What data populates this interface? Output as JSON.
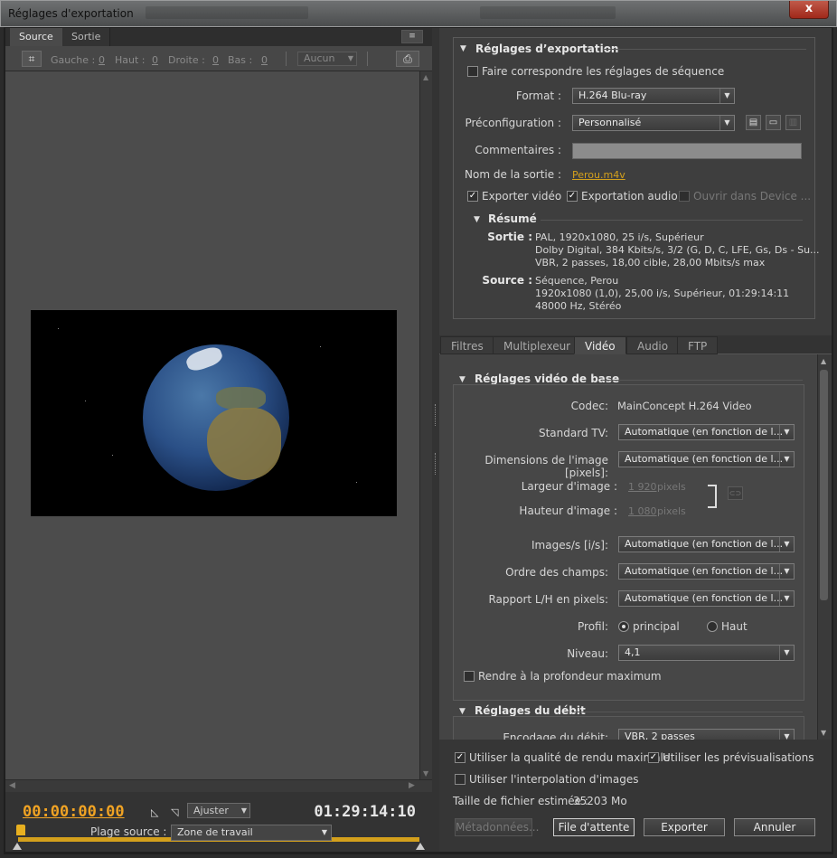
{
  "window": {
    "title": "Réglages d'exportation",
    "close_label": "x"
  },
  "left": {
    "tabs": [
      "Source",
      "Sortie"
    ],
    "panel_menu_label": "≡",
    "crop": {
      "left_label": "Gauche :",
      "left_value": "0",
      "top_label": "Haut :",
      "top_value": "0",
      "right_label": "Droite :",
      "right_value": "0",
      "bottom_label": "Bas :",
      "bottom_value": "0",
      "ratio_value": "Aucun"
    },
    "transport": {
      "timecode_start": "00:00:00:00",
      "timecode_end": "01:29:14:10",
      "zoom_value": "Ajuster"
    },
    "source_range": {
      "label": "Plage source :",
      "value": "Zone de travail"
    }
  },
  "export": {
    "title": "Réglages d’exportation",
    "match_sequence_label": "Faire correspondre les réglages de séquence",
    "format_label": "Format :",
    "format_value": "H.264 Blu-ray",
    "preset_label": "Préconfiguration :",
    "preset_value": "Personnalisé",
    "comments_label": "Commentaires :",
    "output_name_label": "Nom de la sortie :",
    "output_name_value": "Perou.m4v",
    "export_video_label": "Exporter vidéo",
    "export_audio_label": "Exportation audio",
    "open_device_label": "Ouvrir dans Device ...",
    "summary_title": "Résumé",
    "summary_output_label": "Sortie :",
    "summary_output_lines": [
      "PAL, 1920x1080, 25 i/s, Supérieur",
      "Dolby Digital, 384 Kbits/s, 3/2 (G, D, C, LFE, Gs, Ds - Su...",
      "VBR, 2 passes, 18,00 cible, 28,00 Mbits/s max"
    ],
    "summary_source_label": "Source :",
    "summary_source_lines": [
      "Séquence, Perou",
      "1920x1080 (1,0), 25,00 i/s, Supérieur, 01:29:14:11",
      "48000 Hz, Stéréo"
    ]
  },
  "tabs": [
    "Filtres",
    "Multiplexeur",
    "Vidéo",
    "Audio",
    "FTP"
  ],
  "video": {
    "basic_title": "Réglages vidéo de base",
    "codec_label": "Codec:",
    "codec_value": "MainConcept H.264 Video",
    "tv_standard_label": "Standard TV:",
    "tv_standard_value": "Automatique (en fonction de l...",
    "frame_size_label": "Dimensions de l'image [pixels]:",
    "frame_size_value": "Automatique (en fonction de l...",
    "width_label": "Largeur d'image :",
    "width_value": "1 920",
    "height_label": "Hauteur d'image :",
    "height_value": "1 080",
    "unit_pixels": "pixels",
    "fps_label": "Images/s [i/s]:",
    "fps_value": "Automatique (en fonction de l...",
    "field_order_label": "Ordre des champs:",
    "field_order_value": "Automatique (en fonction de l...",
    "aspect_label": "Rapport L/H en pixels:",
    "aspect_value": "Automatique (en fonction de l...",
    "profile_label": "Profil:",
    "profile_main": "principal",
    "profile_high": "Haut",
    "level_label": "Niveau:",
    "level_value": "4,1",
    "max_depth_label": "Rendre à la profondeur maximum",
    "bitrate_title": "Réglages du débit",
    "bitrate_encoding_label": "Encodage du débit:",
    "bitrate_encoding_value": "VBR, 2 passes"
  },
  "bottom": {
    "max_render_label": "Utiliser la qualité de rendu maximale",
    "use_previews_label": "Utiliser les prévisualisations",
    "frame_blending_label": "Utiliser l'interpolation d'images",
    "file_size_label": "Taille de fichier estimée :",
    "file_size_value": "35203 Mo",
    "metadata_label": "Métadonnées...",
    "queue_label": "File d'attente",
    "export_label": "Exporter",
    "cancel_label": "Annuler"
  }
}
